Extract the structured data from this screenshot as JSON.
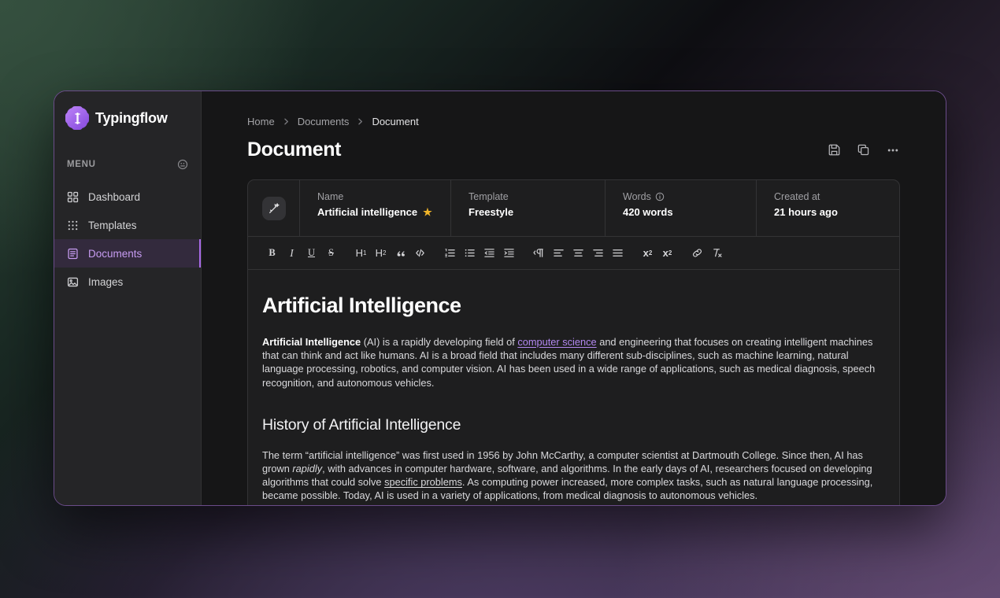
{
  "brand": {
    "name": "Typingflow",
    "logo_icon": "chip-brain-icon"
  },
  "sidebar": {
    "menu_heading": "MENU",
    "menu_heading_icon": "help-circle-icon",
    "items": [
      {
        "label": "Dashboard",
        "icon": "grid-squares-icon",
        "active": false
      },
      {
        "label": "Templates",
        "icon": "dots-grid-icon",
        "active": false
      },
      {
        "label": "Documents",
        "icon": "document-list-icon",
        "active": true
      },
      {
        "label": "Images",
        "icon": "image-icon",
        "active": false
      }
    ]
  },
  "header": {
    "breadcrumb": [
      {
        "label": "Home"
      },
      {
        "label": "Documents"
      },
      {
        "label": "Document"
      }
    ],
    "breadcrumb_separator_icon": "chevron-right-icon",
    "title": "Document",
    "actions": [
      {
        "name": "save-button",
        "icon": "save-disk-icon"
      },
      {
        "name": "duplicate-button",
        "icon": "copy-icon"
      },
      {
        "name": "more-options-button",
        "icon": "ellipsis-icon"
      }
    ]
  },
  "meta": {
    "doc_icon": "magic-wand-icon",
    "fields": [
      {
        "label": "Name",
        "value": "Artificial intelligence",
        "badge_icon": "star-icon",
        "starred": true
      },
      {
        "label": "Template",
        "value": "Freestyle"
      },
      {
        "label": "Words",
        "value": "420 words",
        "info_icon": "info-circle-icon"
      },
      {
        "label": "Created at",
        "value": "21 hours ago"
      }
    ]
  },
  "toolbar": {
    "groups": [
      [
        {
          "name": "bold-button",
          "label": "B",
          "icon": "bold-icon"
        },
        {
          "name": "italic-button",
          "label": "I",
          "icon": "italic-icon"
        },
        {
          "name": "underline-button",
          "label": "U",
          "icon": "underline-icon"
        },
        {
          "name": "strikethrough-button",
          "label": "S",
          "icon": "strikethrough-icon"
        }
      ],
      [
        {
          "name": "heading-1-button",
          "label": "H1",
          "icon": "h1-icon"
        },
        {
          "name": "heading-2-button",
          "label": "H2",
          "icon": "h2-icon"
        },
        {
          "name": "blockquote-button",
          "label": "”",
          "icon": "quote-icon"
        },
        {
          "name": "code-block-button",
          "label": "</>",
          "icon": "code-icon"
        }
      ],
      [
        {
          "name": "ordered-list-button",
          "icon": "ordered-list-icon"
        },
        {
          "name": "bullet-list-button",
          "icon": "bullet-list-icon"
        },
        {
          "name": "outdent-button",
          "icon": "outdent-icon"
        },
        {
          "name": "indent-button",
          "icon": "indent-icon"
        }
      ],
      [
        {
          "name": "text-direction-button",
          "icon": "paragraph-direction-icon"
        },
        {
          "name": "align-left-button",
          "icon": "align-left-icon"
        },
        {
          "name": "align-center-button",
          "icon": "align-center-icon"
        },
        {
          "name": "align-right-button",
          "icon": "align-right-icon"
        },
        {
          "name": "align-justify-button",
          "icon": "align-justify-icon"
        }
      ],
      [
        {
          "name": "subscript-button",
          "label": "x₂",
          "icon": "subscript-icon"
        },
        {
          "name": "superscript-button",
          "label": "x²",
          "icon": "superscript-icon"
        }
      ],
      [
        {
          "name": "insert-link-button",
          "icon": "link-icon"
        },
        {
          "name": "clear-formatting-button",
          "icon": "clear-format-icon"
        }
      ]
    ]
  },
  "document": {
    "h1": "Artificial Intelligence",
    "p1": {
      "lead_bold": "Artificial Intelligence",
      "before_link": " (AI) is a rapidly developing field of ",
      "link_text": "computer science",
      "after_link": " and engineering that focuses on creating intelligent machines that can think and act like humans. AI is a broad field that includes many different sub-disciplines, such as machine learning, natural language processing, robotics, and computer vision. AI has been used in a wide range of applications, such as medical diagnosis, speech recognition, and autonomous vehicles."
    },
    "h2": "History of Artificial Intelligence",
    "p2": {
      "part1": "The term “artificial intelligence” was first used in 1956 by John McCarthy, a computer scientist at Dartmouth College. Since then, AI has grown ",
      "italic": "rapidly",
      "part2": ", with advances in computer hardware, software, and algorithms. In the early days of AI, researchers focused on developing algorithms that could solve ",
      "underline": "specific problems",
      "part3": ". As computing power increased, more complex tasks, such as natural language processing, became possible. Today, AI is used in a variety of applications, from medical diagnosis to autonomous vehicles."
    }
  },
  "colors": {
    "accent_purple": "#a96ae8",
    "link_purple": "#b388f0",
    "star_yellow": "#f0b429",
    "window_border": "#6b4c8a",
    "sidebar_bg": "#252527",
    "main_bg": "#161617",
    "card_bg": "#1e1e1f"
  }
}
